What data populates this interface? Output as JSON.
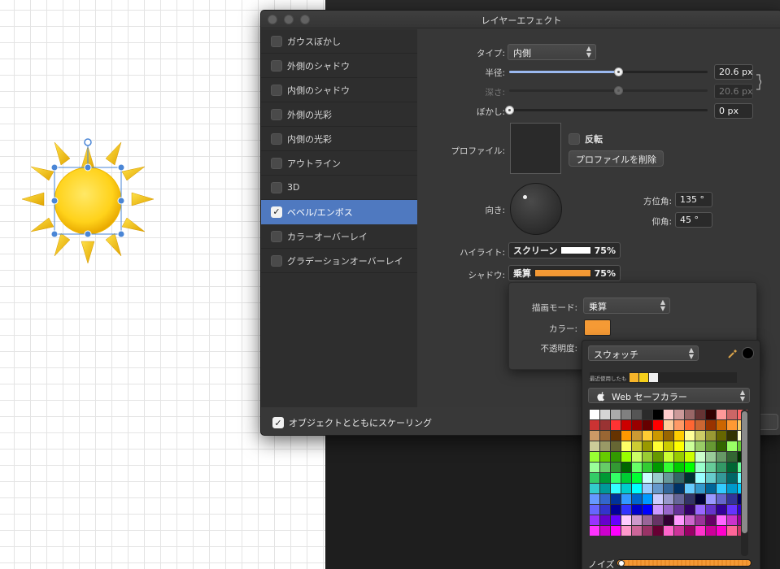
{
  "window": {
    "title": "レイヤーエフェクト"
  },
  "effects": [
    {
      "label": "ガウスぼかし",
      "checked": false,
      "selected": false
    },
    {
      "label": "外側のシャドウ",
      "checked": false,
      "selected": false
    },
    {
      "label": "内側のシャドウ",
      "checked": false,
      "selected": false
    },
    {
      "label": "外側の光彩",
      "checked": false,
      "selected": false
    },
    {
      "label": "内側の光彩",
      "checked": false,
      "selected": false
    },
    {
      "label": "アウトライン",
      "checked": false,
      "selected": false
    },
    {
      "label": "3D",
      "checked": false,
      "selected": false
    },
    {
      "label": "ベベル/エンボス",
      "checked": true,
      "selected": true
    },
    {
      "label": "カラーオーバーレイ",
      "checked": false,
      "selected": false
    },
    {
      "label": "グラデーションオーバーレイ",
      "checked": false,
      "selected": false
    }
  ],
  "scale_with_object": {
    "label": "オブジェクトとともにスケーリング",
    "checked": true
  },
  "settings": {
    "type_label": "タイプ:",
    "type_value": "内側",
    "radius_label": "半径:",
    "radius_value": "20.6 px",
    "radius_fraction": 0.55,
    "depth_label": "深さ:",
    "depth_value": "20.6 px",
    "depth_fraction": 0.55,
    "blur_label": "ぼかし:",
    "blur_value": "0 px",
    "blur_fraction": 0.0,
    "profile_label": "プロファイル:",
    "invert_label": "反転",
    "delete_profile_label": "プロファイルを削除",
    "direction_label": "向き:",
    "azimuth_label": "方位角:",
    "azimuth_value": "135 °",
    "elevation_label": "仰角:",
    "elevation_value": "45 °",
    "highlight_label": "ハイライト:",
    "highlight_mode": "スクリーン",
    "highlight_color": "#ffffff",
    "highlight_opacity": "75%",
    "shadow_label": "シャドウ:",
    "shadow_mode": "乗算",
    "shadow_color": "#f59a35",
    "shadow_opacity": "75%"
  },
  "blend_panel": {
    "blend_mode_label": "描画モード:",
    "blend_mode_value": "乗算",
    "color_label": "カラー:",
    "color_value": "#f59a35",
    "opacity_label": "不透明度:"
  },
  "swatch_panel": {
    "type_value": "スウォッチ",
    "recent_label": "最近使用したも",
    "recent_colors": [
      "#f7b52a",
      "#f5cf1b",
      "#f0f0f0"
    ],
    "palette_name": "Web セーフカラー",
    "noise_label": "ノイズ",
    "palette_rows": [
      [
        "#ffffff",
        "#d5d5d5",
        "#aaaaaa",
        "#808080",
        "#555555",
        "#2b2b2b",
        "#000000",
        "#ffcccc",
        "#cc9999",
        "#996666",
        "#663333",
        "#330000",
        "#ff9999",
        "#cc6666",
        "#ff6666"
      ],
      [
        "#cc3333",
        "#993333",
        "#ff3333",
        "#cc0000",
        "#990000",
        "#660000",
        "#ff0000",
        "#ffcc99",
        "#ff9966",
        "#ff6633",
        "#cc6633",
        "#993300",
        "#cc6600",
        "#ff9933",
        "#ffcc66"
      ],
      [
        "#cc9966",
        "#996633",
        "#663300",
        "#ff9900",
        "#cc9933",
        "#ffcc33",
        "#cc9900",
        "#996600",
        "#ffcc00",
        "#ffff99",
        "#cccc66",
        "#999933",
        "#666600",
        "#333300",
        "#ffffcc"
      ],
      [
        "#cccc99",
        "#999966",
        "#666633",
        "#ffff66",
        "#cccc33",
        "#999900",
        "#ffff33",
        "#cccc00",
        "#ffff00",
        "#ccff99",
        "#99cc66",
        "#669933",
        "#336600",
        "#99ff66",
        "#66cc33"
      ],
      [
        "#99ff33",
        "#66cc00",
        "#339900",
        "#99ff00",
        "#ccff66",
        "#99cc33",
        "#669900",
        "#ccff33",
        "#99cc00",
        "#ccff00",
        "#ccffcc",
        "#99cc99",
        "#669966",
        "#336633",
        "#003300"
      ],
      [
        "#99ff99",
        "#66cc66",
        "#339933",
        "#006600",
        "#66ff66",
        "#33cc33",
        "#009900",
        "#33ff33",
        "#00cc00",
        "#00ff00",
        "#99ffcc",
        "#66cc99",
        "#339966",
        "#006633",
        "#66ff99"
      ],
      [
        "#33cc66",
        "#009933",
        "#33ff66",
        "#00cc33",
        "#00ff33",
        "#ccffff",
        "#99cccc",
        "#669999",
        "#336666",
        "#003333",
        "#99ffff",
        "#66cccc",
        "#339999",
        "#006666",
        "#66ffff"
      ],
      [
        "#33cccc",
        "#009999",
        "#33ffff",
        "#00cccc",
        "#00ffff",
        "#99ccff",
        "#6699cc",
        "#336699",
        "#003366",
        "#66ccff",
        "#3399cc",
        "#006699",
        "#33ccff",
        "#0099cc",
        "#00ccff"
      ],
      [
        "#6699ff",
        "#3366cc",
        "#003399",
        "#3399ff",
        "#0066cc",
        "#0099ff",
        "#ccccff",
        "#9999cc",
        "#666699",
        "#333366",
        "#000033",
        "#9999ff",
        "#6666cc",
        "#333399",
        "#000066"
      ],
      [
        "#6666ff",
        "#3333cc",
        "#000099",
        "#3333ff",
        "#0000cc",
        "#0000ff",
        "#cc99ff",
        "#9966cc",
        "#663399",
        "#330066",
        "#9966ff",
        "#6633cc",
        "#330099",
        "#6633ff",
        "#3300cc"
      ],
      [
        "#9933ff",
        "#6600cc",
        "#6600ff",
        "#ffccff",
        "#cc99cc",
        "#996699",
        "#663366",
        "#330033",
        "#ff99ff",
        "#cc66cc",
        "#993399",
        "#660066",
        "#ff66ff",
        "#cc33cc",
        "#990099"
      ],
      [
        "#ff33ff",
        "#cc00cc",
        "#ff00ff",
        "#ff99cc",
        "#cc6699",
        "#993366",
        "#660033",
        "#ff66cc",
        "#cc3399",
        "#990066",
        "#ff33cc",
        "#cc0099",
        "#ff00cc",
        "#ff6699",
        "#cc3366"
      ]
    ]
  }
}
